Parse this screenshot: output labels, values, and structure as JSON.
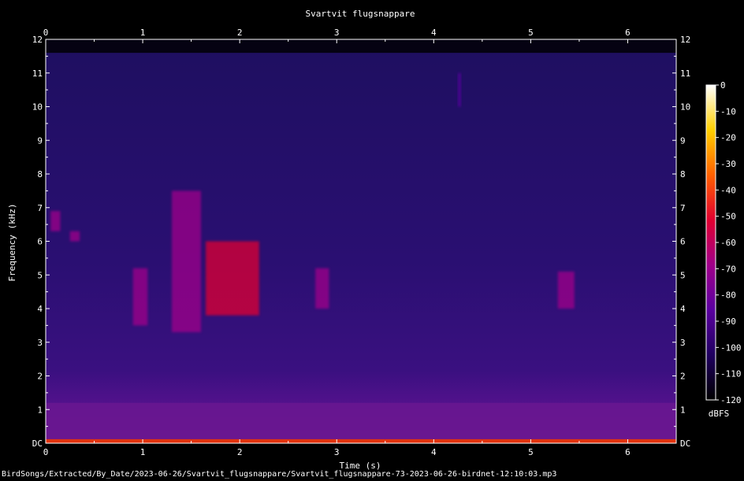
{
  "chart_data": {
    "type": "heatmap",
    "title": "Svartvit flugsnappare",
    "xlabel": "Time (s)",
    "ylabel": "Frequency (kHz)",
    "xlim": [
      0,
      6.5
    ],
    "ylim": [
      0,
      12
    ],
    "x_ticks": [
      0,
      1,
      2,
      3,
      4,
      5,
      6
    ],
    "y_ticks": [
      "DC",
      "1",
      "2",
      "3",
      "4",
      "5",
      "6",
      "7",
      "8",
      "9",
      "10",
      "11",
      "12"
    ],
    "colorbar": {
      "label": "dBFS",
      "range": [
        -120,
        0
      ],
      "ticks": [
        "0",
        "-10",
        "-20",
        "-30",
        "-40",
        "-50",
        "-60",
        "-70",
        "-80",
        "-90",
        "-100",
        "-110",
        "-120"
      ],
      "colors": [
        "#000000",
        "#200060",
        "#5a00a0",
        "#a0008a",
        "#e00030",
        "#ff6000",
        "#ffd000",
        "#ffffff"
      ]
    },
    "background_level_dbfs": -95,
    "noise_floor_band_khz": [
      0,
      1.2
    ],
    "events": [
      {
        "t": [
          0.9,
          1.05
        ],
        "f": [
          3.5,
          5.2
        ],
        "level": -65
      },
      {
        "t": [
          1.3,
          1.6
        ],
        "f": [
          3.3,
          7.5
        ],
        "level": -70
      },
      {
        "t": [
          1.65,
          2.2
        ],
        "f": [
          3.8,
          6.0
        ],
        "level": -55
      },
      {
        "t": [
          2.78,
          2.92
        ],
        "f": [
          4.0,
          5.2
        ],
        "level": -65
      },
      {
        "t": [
          5.28,
          5.45
        ],
        "f": [
          4.0,
          5.1
        ],
        "level": -65
      },
      {
        "t": [
          0.05,
          0.15
        ],
        "f": [
          6.3,
          6.9
        ],
        "level": -70
      },
      {
        "t": [
          0.25,
          0.35
        ],
        "f": [
          6.0,
          6.3
        ],
        "level": -72
      },
      {
        "t": [
          4.25,
          4.28
        ],
        "f": [
          10.0,
          11.0
        ],
        "level": -80
      }
    ]
  },
  "footer": {
    "path": "BirdSongs/Extracted/By_Date/2023-06-26/Svartvit_flugsnappare/Svartvit_flugsnappare-73-2023-06-26-birdnet-12:10:03.mp3"
  }
}
